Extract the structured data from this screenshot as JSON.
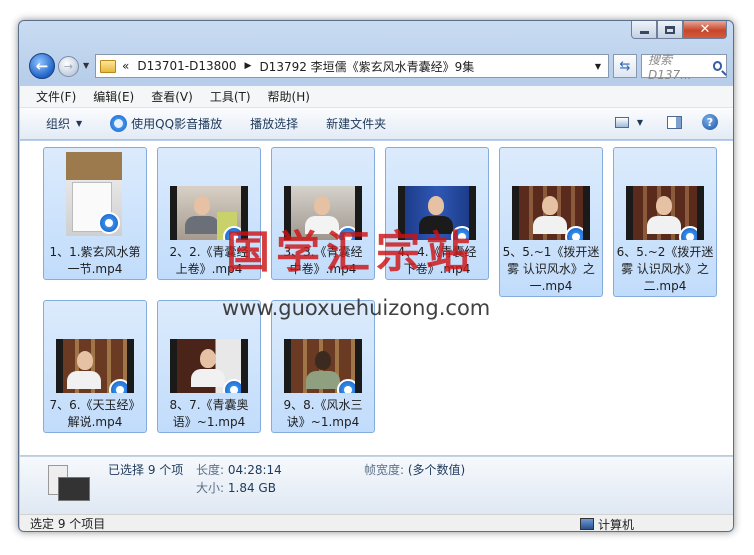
{
  "window": {
    "minimize_label": "",
    "controls": [
      "minimize",
      "maximize",
      "close"
    ]
  },
  "address": {
    "overflow": "«",
    "crumbs": [
      "D13701-D13800",
      "D13792 李垣儒《紫玄风水青囊经》9集"
    ]
  },
  "search": {
    "placeholder": "搜索 D137..."
  },
  "menu": [
    "文件(F)",
    "编辑(E)",
    "查看(V)",
    "工具(T)",
    "帮助(H)"
  ],
  "toolbar": {
    "organize": "组织",
    "play_qq": "使用QQ影音播放",
    "play_selection": "播放选择",
    "new_folder": "新建文件夹"
  },
  "files": [
    {
      "line1": "1、1.紫玄风水第",
      "line2": "一节.mp4"
    },
    {
      "line1": "2、2.《青囊经",
      "line2": "上卷》.mp4"
    },
    {
      "line1": "3、3.《青囊经",
      "line2": "中卷》.mp4"
    },
    {
      "line1": "4、4.《青囊经",
      "line2": "下卷》.mp4"
    },
    {
      "line1": "5、5.~1《拨开迷",
      "line2": "雾 认识风水》之",
      "line3": "一.mp4"
    },
    {
      "line1": "6、5.~2《拨开迷",
      "line2": "雾 认识风水》之",
      "line3": "二.mp4"
    },
    {
      "line1": "7、6.《天玉经》",
      "line2": "解说.mp4"
    },
    {
      "line1": "8、7.《青囊奥",
      "line2": "语》~1.mp4"
    },
    {
      "line1": "9、8.《风水三",
      "line2": "诀》~1.mp4"
    }
  ],
  "watermark": {
    "cn": "国学汇宗站",
    "url": "www.guoxuehuizong.com"
  },
  "details": {
    "selected": "已选择 9 个项",
    "length_label": "长度:",
    "length_value": "04:28:14",
    "size_label": "大小:",
    "size_value": "1.84 GB",
    "frame_label": "帧宽度:",
    "frame_value": "(多个数值)"
  },
  "status": {
    "left": "选定 9 个项目",
    "zone": "计算机"
  },
  "colors": {
    "selection": "#c1dcfb",
    "selection_border": "#84acdd",
    "watermark": "#cd1414"
  }
}
